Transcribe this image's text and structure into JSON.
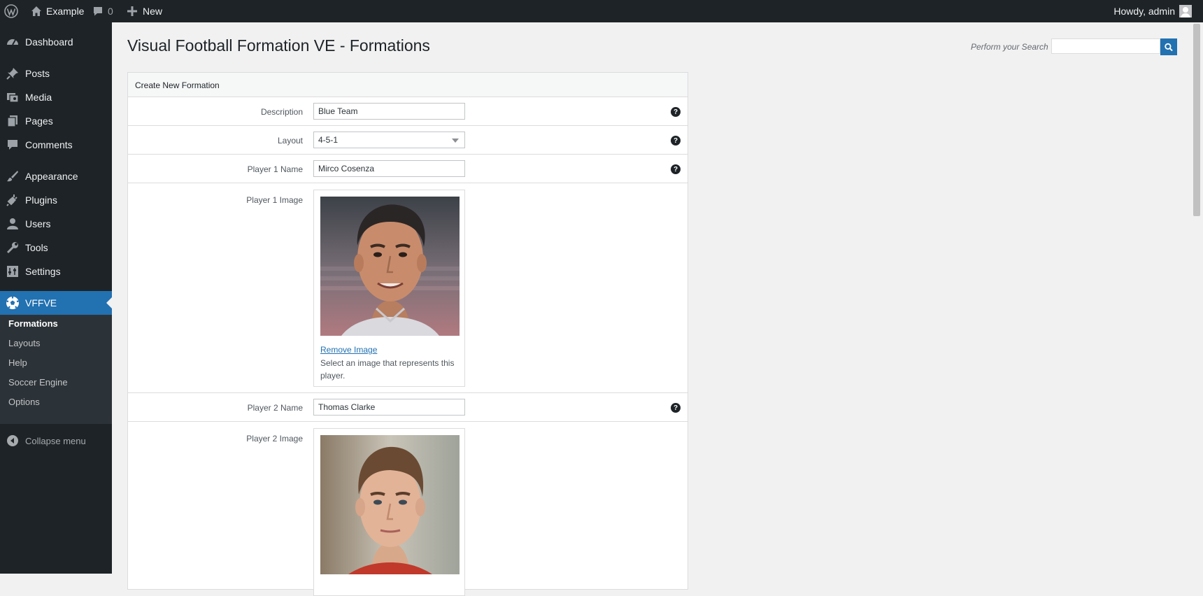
{
  "adminbar": {
    "site_name": "Example",
    "comments_count": "0",
    "new_label": "New",
    "howdy": "Howdy, admin"
  },
  "sidebar": {
    "items": [
      {
        "label": "Dashboard",
        "icon": "dashboard-icon"
      },
      {
        "label": "Posts",
        "icon": "pin-icon"
      },
      {
        "label": "Media",
        "icon": "media-icon"
      },
      {
        "label": "Pages",
        "icon": "pages-icon"
      },
      {
        "label": "Comments",
        "icon": "comment-icon"
      },
      {
        "label": "Appearance",
        "icon": "brush-icon"
      },
      {
        "label": "Plugins",
        "icon": "plug-icon"
      },
      {
        "label": "Users",
        "icon": "user-icon"
      },
      {
        "label": "Tools",
        "icon": "wrench-icon"
      },
      {
        "label": "Settings",
        "icon": "settings-icon"
      },
      {
        "label": "VFFVE",
        "icon": "soccer-ball-icon"
      }
    ],
    "submenu": [
      "Formations",
      "Layouts",
      "Help",
      "Soccer Engine",
      "Options"
    ],
    "collapse_label": "Collapse menu"
  },
  "page": {
    "title": "Visual Football Formation VE - Formations",
    "search_label": "Perform your Search",
    "search_value": ""
  },
  "panel": {
    "header": "Create New Formation",
    "description": {
      "label": "Description",
      "value": "Blue Team"
    },
    "layout": {
      "label": "Layout",
      "value": "4-5-1"
    },
    "player1_name": {
      "label": "Player 1 Name",
      "value": "Mirco Cosenza"
    },
    "player1_image": {
      "label": "Player 1 Image",
      "remove_label": "Remove Image",
      "hint": "Select an image that represents this player."
    },
    "player2_name": {
      "label": "Player 2 Name",
      "value": "Thomas Clarke"
    },
    "player2_image": {
      "label": "Player 2 Image"
    },
    "help_glyph": "?"
  },
  "colors": {
    "adminbar_bg": "#1d2327",
    "accent": "#2271b1",
    "page_bg": "#f1f1f1"
  }
}
